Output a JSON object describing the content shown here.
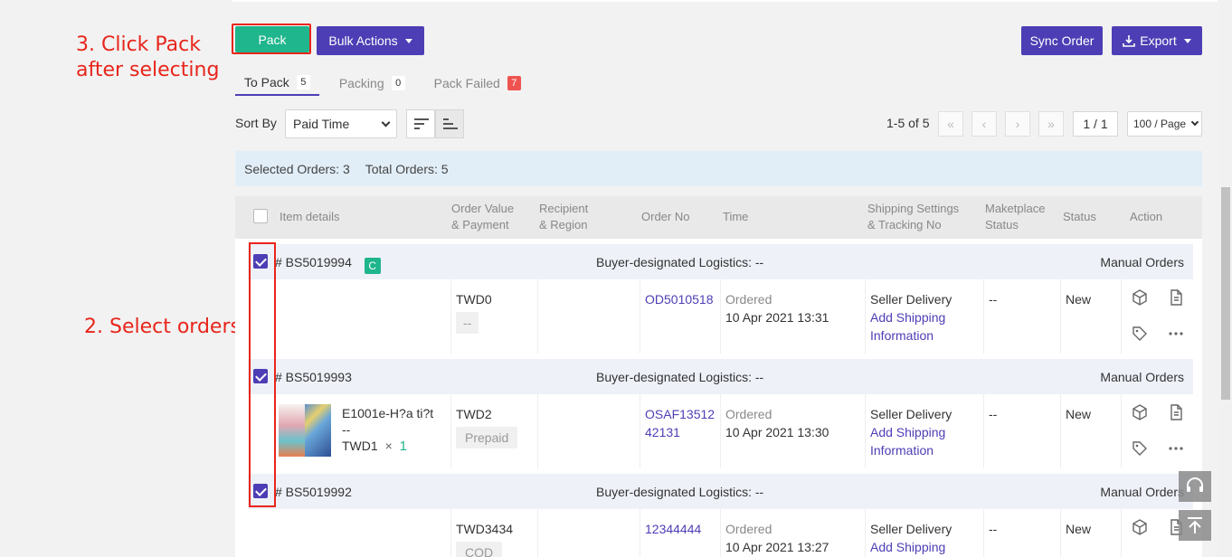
{
  "annotations": {
    "step3_line1": "3. Click Pack",
    "step3_line2": "after selecting",
    "step2": "2. Select orders"
  },
  "toolbar": {
    "pack_label": "Pack",
    "bulk_actions_label": "Bulk Actions",
    "sync_order_label": "Sync Order",
    "export_label": "Export"
  },
  "tabs": [
    {
      "label": "To Pack",
      "count": "5",
      "active": true
    },
    {
      "label": "Packing",
      "count": "0",
      "active": false
    },
    {
      "label": "Pack Failed",
      "count": "7",
      "active": false
    }
  ],
  "sort": {
    "label": "Sort By",
    "selected": "Paid Time"
  },
  "pagination": {
    "range": "1-5 of 5",
    "first": "«",
    "prev": "‹",
    "next": "›",
    "last": "»",
    "page": "1 / 1",
    "page_size": "100 / Page"
  },
  "summary": {
    "selected": "Selected Orders: 3",
    "total": "Total Orders: 5"
  },
  "columns": {
    "item_details": "Item details",
    "order_value_1": "Order Value",
    "order_value_2": "& Payment",
    "recipient_1": "Recipient",
    "recipient_2": "& Region",
    "order_no": "Order No",
    "time": "Time",
    "shipping_1": "Shipping Settings",
    "shipping_2": "& Tracking No",
    "marketplace_1": "Maketplace",
    "marketplace_2": "Status",
    "status": "Status",
    "action": "Action"
  },
  "orders": [
    {
      "number": "# BS5019994",
      "badge": "C",
      "logistics": "Buyer-designated Logistics: --",
      "source": "Manual Orders",
      "value": "TWD0",
      "payment": "--",
      "order_no": "OD5010518",
      "time_label": "Ordered",
      "time": "10 Apr 2021 13:31",
      "shipping": "Seller Delivery",
      "add_shipping_1": "Add Shipping",
      "add_shipping_2": "Information",
      "marketplace_status": "--",
      "status": "New"
    },
    {
      "number": "# BS5019993",
      "logistics": "Buyer-designated Logistics: --",
      "source": "Manual Orders",
      "item_name_1": "E1001e-H?a ti?t",
      "item_name_2": "--",
      "item_price": "TWD1",
      "item_times": "×",
      "item_qty": "1",
      "value": "TWD2",
      "payment": "Prepaid",
      "order_no_1": "OSAF13512",
      "order_no_2": "42131",
      "time_label": "Ordered",
      "time": "10 Apr 2021 13:30",
      "shipping": "Seller Delivery",
      "add_shipping_1": "Add Shipping",
      "add_shipping_2": "Information",
      "marketplace_status": "--",
      "status": "New"
    },
    {
      "number": "# BS5019992",
      "logistics": "Buyer-designated Logistics: --",
      "source": "Manual Orders",
      "value": "TWD3434",
      "payment": "COD",
      "order_no": "12344444",
      "time_label": "Ordered",
      "time": "10 Apr 2021 13:27",
      "shipping": "Seller Delivery",
      "add_shipping_1": "Add Shipping",
      "marketplace_status": "--",
      "status": "New"
    }
  ],
  "colors": {
    "accent": "#4d3eb5",
    "pack_green": "#1fb58d",
    "annotation_red": "#e8251b",
    "summary_bg": "#e1eef8"
  }
}
